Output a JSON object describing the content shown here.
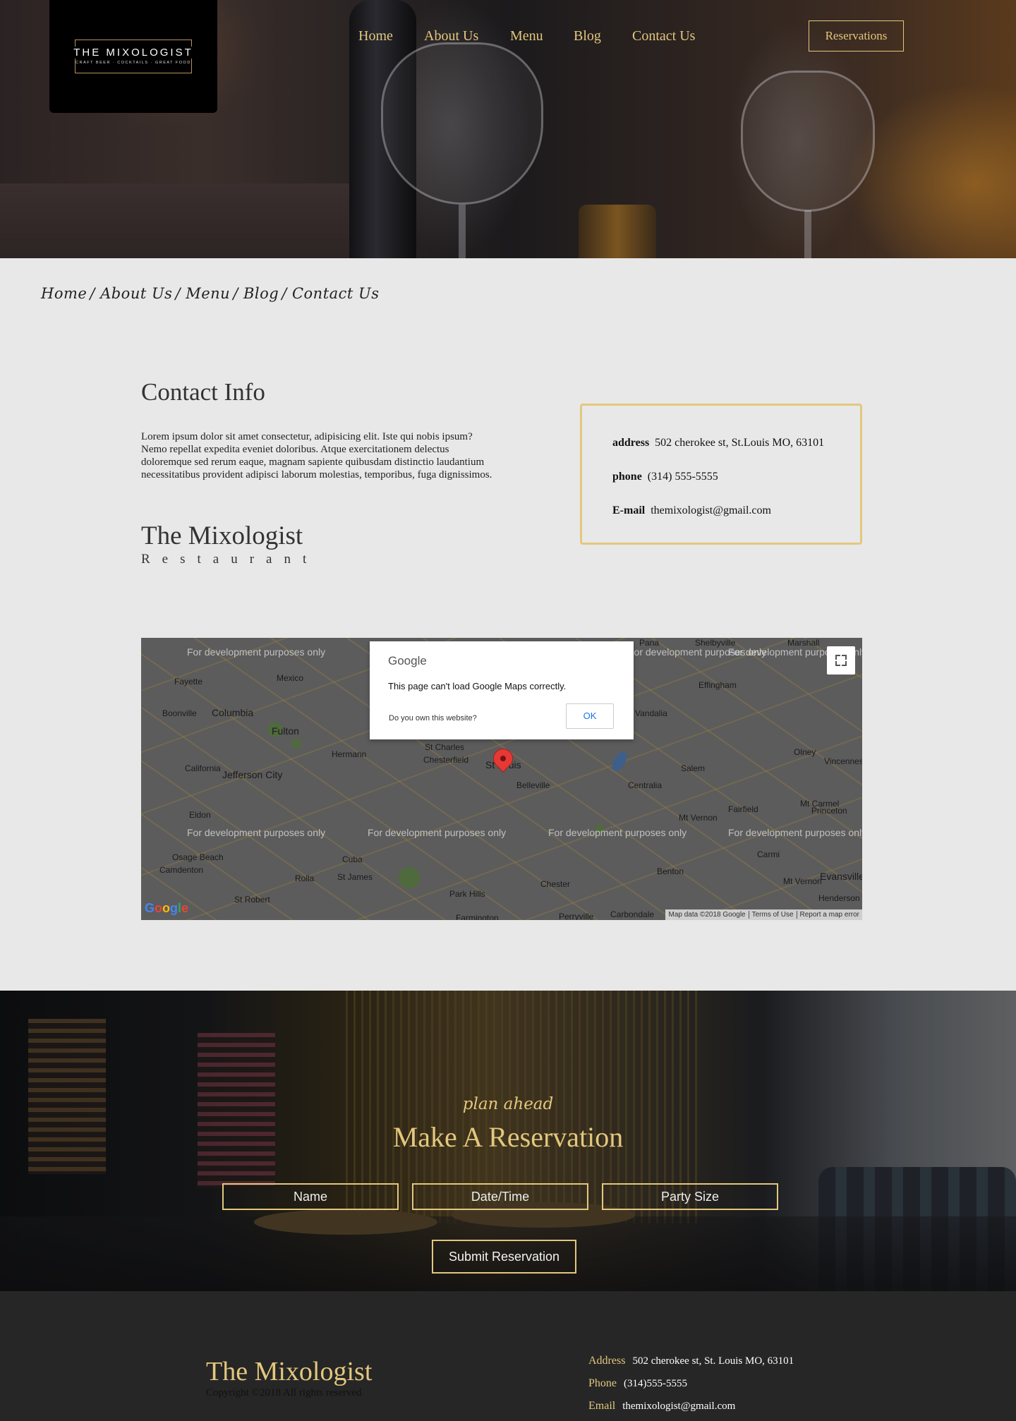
{
  "header": {
    "logo": {
      "name": "THE MIXOLOGIST",
      "tagline": "CRAFT BEER · COCKTAILS · GREAT FOOD"
    },
    "nav": [
      "Home",
      "About Us",
      "Menu",
      "Blog",
      "Contact Us"
    ],
    "reservations_label": "Reservations"
  },
  "breadcrumb": [
    "Home",
    "About Us",
    "Menu",
    "Blog",
    "Contact Us"
  ],
  "contact": {
    "title": "Contact Info",
    "text": "Lorem ipsum dolor sit amet consectetur, adipisicing elit. Iste qui nobis ipsum? Nemo repellat expedita eveniet doloribus. Atque exercitationem delectus doloremque sed rerum eaque, magnam sapiente quibusdam distinctio laudantium necessitatibus provident adipisci laborum molestias, temporibus, fuga dignissimos.",
    "brand": "The Mixologist",
    "brand_sub": "Restaurant",
    "info": {
      "address_label": "address",
      "address": "502 cherokee st, St.Louis MO, 63101",
      "phone_label": "phone",
      "phone": "(314) 555-5555",
      "email_label": "E-mail",
      "email": "themixologist@gmail.com"
    }
  },
  "map": {
    "watermark": "For development purposes only",
    "places": [
      "Fayette",
      "Mexico",
      "Boonville",
      "Columbia",
      "Fulton",
      "California",
      "Jefferson City",
      "Hermann",
      "St Charles",
      "Chesterfield",
      "St Louis",
      "Belleville",
      "Vandalia",
      "Effingham",
      "Salem",
      "Olney",
      "Centralia",
      "Mt Vernon",
      "Fairfield",
      "Mt Carmel",
      "Eldon",
      "Osage Beach",
      "Camdenton",
      "Cuba",
      "Rolla",
      "St James",
      "Park Hills",
      "Chester",
      "Benton",
      "Carmi",
      "Mt Vernon",
      "Evansville",
      "Henderson",
      "Vincennes",
      "Princeton",
      "Marshall",
      "Shelbyville",
      "Pana",
      "St Robert",
      "Farmington",
      "Perryville",
      "Carbondale"
    ],
    "dialog": {
      "logo": "Google",
      "message": "This page can't load Google Maps correctly.",
      "question": "Do you own this website?",
      "ok": "OK"
    },
    "attribution": [
      "Map data ©2018 Google",
      "Terms of Use",
      "Report a map error"
    ],
    "google_logo": "Google"
  },
  "reservation": {
    "kicker": "plan ahead",
    "title": "Make A Reservation",
    "fields": [
      "Name",
      "Date/Time",
      "Party Size"
    ],
    "submit": "Submit Reservation"
  },
  "footer": {
    "brand": "The Mixologist",
    "copyright": "Copyright ©2018 All rights reserved",
    "address_label": "Address",
    "address": "502 cherokee st, St. Louis MO, 63101",
    "phone_label": "Phone",
    "phone": "(314)555-5555",
    "email_label": "Email",
    "email": "themixologist@gmail.com"
  },
  "colors": {
    "accent": "#e3c77d",
    "page_bg": "#e8e8e8",
    "footer_bg": "#262626"
  }
}
